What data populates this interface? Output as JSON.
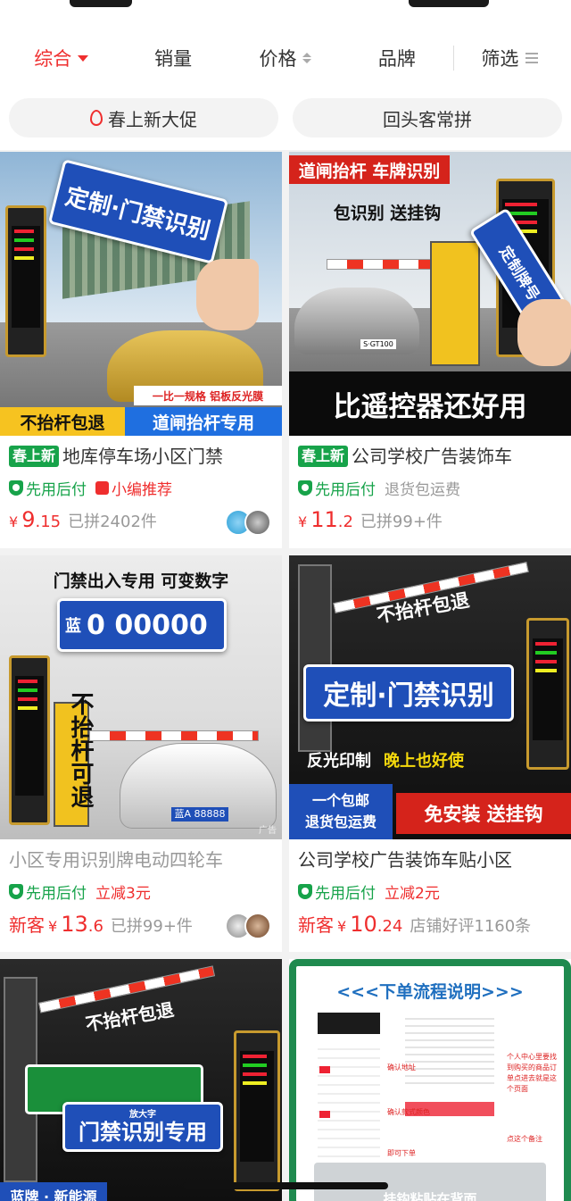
{
  "sort_tabs": [
    {
      "label": "综合",
      "active": true
    },
    {
      "label": "销量"
    },
    {
      "label": "价格"
    },
    {
      "label": "品牌"
    },
    {
      "label": "筛选"
    }
  ],
  "chips": [
    "春上新大促",
    "回头客常拼"
  ],
  "colors": {
    "accent": "#ef2e2e",
    "green": "#17a34a",
    "plate_blue": "#1f4fb8"
  },
  "products": [
    {
      "badge": "春上新",
      "title": "地库停车场小区门禁",
      "tags": [
        "先用后付",
        "小编推荐"
      ],
      "currency": "¥",
      "price_int": "9",
      "price_dec": ".15",
      "sold": "已拼2402件",
      "image": {
        "plate_text": "定制·门禁识别",
        "bottom_left": "不抬杆包退",
        "bottom_right": "道闸抬杆专用",
        "top_note": "一比一规格  铝板反光膜"
      }
    },
    {
      "badge": "春上新",
      "title": "公司学校广告装饰车",
      "tags": [
        "先用后付",
        "退货包运费"
      ],
      "currency": "¥",
      "price_int": "11",
      "price_dec": ".2",
      "sold": "已拼99+件",
      "image": {
        "top_banner": "道闸抬杆 车牌识别",
        "sub_banner": "包识别 送挂钩",
        "plate_text": "定制牌号",
        "car_plate": "S·GT100",
        "bottom": "比遥控器还好用"
      }
    },
    {
      "title": "小区专用识别牌电动四轮车",
      "tags": [
        "先用后付",
        "立减3元"
      ],
      "new_customer": "新客",
      "currency": "¥",
      "price_int": "13",
      "price_dec": ".6",
      "sold": "已拼99+件",
      "image": {
        "top": "门禁出入专用 可变数字",
        "plate_prefix": "蓝",
        "plate_digits": "0 00000",
        "vertical": "不抬杆可退",
        "car_plate": "蓝A 88888",
        "ad": "广告"
      }
    },
    {
      "title": "公司学校广告装饰车贴小区",
      "tags": [
        "先用后付",
        "立减2元"
      ],
      "new_customer": "新客",
      "currency": "¥",
      "price_int": "10",
      "price_dec": ".24",
      "sold": "店铺好评1160条",
      "image": {
        "top": "不抬杆包退",
        "plate_text": "定制·门禁识别",
        "line_white": "反光印制",
        "line_yellow": "晚上也好使",
        "left_badge_1": "一个包邮",
        "left_badge_2": "退货包运费",
        "right_badge": "免安装 送挂钩"
      }
    },
    {
      "image": {
        "top": "不抬杆包退",
        "plate_small": "放大字",
        "plate_text": "门禁识别专用",
        "bottom": "蓝牌 · 新能源"
      }
    },
    {
      "image": {
        "header": "<<<下单流程说明>>>",
        "note_1": "确认地址",
        "note_2": "确认款式颜色",
        "note_3": "即可下单",
        "note_right": "个人中心里要找到购买的商品订单点进去就是这个页面",
        "note_bottom": "点这个备注",
        "footer": "挂钩粘贴在背面"
      }
    }
  ]
}
